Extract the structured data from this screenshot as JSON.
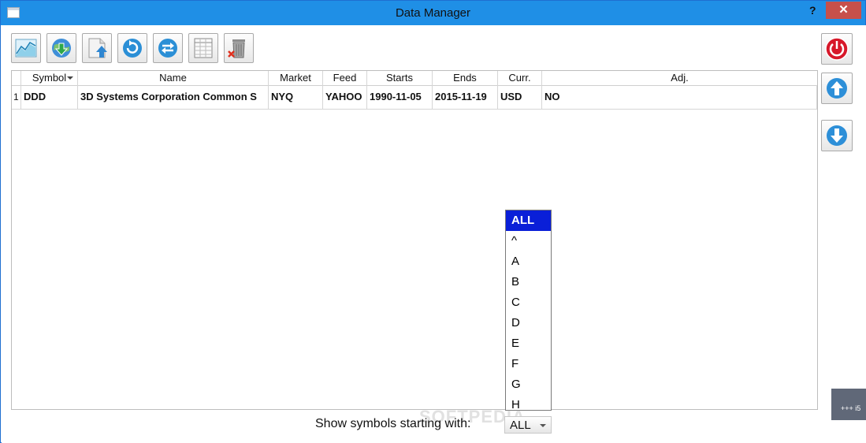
{
  "window": {
    "title": "Data Manager",
    "help": "?",
    "close": "✕"
  },
  "toolbar": [
    {
      "name": "chart-button",
      "icon": "chart-icon"
    },
    {
      "name": "download-button",
      "icon": "globe-download-icon"
    },
    {
      "name": "import-button",
      "icon": "document-upload-icon"
    },
    {
      "name": "refresh-button",
      "icon": "refresh-icon"
    },
    {
      "name": "sync-button",
      "icon": "sync-icon"
    },
    {
      "name": "table-button",
      "icon": "table-icon"
    },
    {
      "name": "delete-button",
      "icon": "trash-icon"
    }
  ],
  "table": {
    "columns": [
      "Symbol",
      "Name",
      "Market",
      "Feed",
      "Starts",
      "Ends",
      "Curr.",
      "Adj."
    ],
    "rows": [
      {
        "num": "1",
        "cells": [
          "DDD",
          "3D Systems Corporation Common S",
          "NYQ",
          "YAHOO",
          "1990-11-05",
          "2015-11-19",
          "USD",
          "NO"
        ]
      }
    ]
  },
  "side_buttons": [
    {
      "name": "power-button",
      "icon": "power-icon"
    },
    {
      "name": "move-up-button",
      "icon": "arrow-up-icon"
    },
    {
      "name": "move-down-button",
      "icon": "arrow-down-icon"
    }
  ],
  "filter": {
    "label": "Show symbols starting with:",
    "value": "ALL",
    "options": [
      "ALL",
      "^",
      "A",
      "B",
      "C",
      "D",
      "E",
      "F",
      "G",
      "H"
    ],
    "selected_index": 0
  },
  "watermark": "SOFTPEDIA",
  "corner_text": "+++ i5",
  "colors": {
    "titlebar": "#1f8fe6",
    "close": "#c7504b",
    "selection": "#0a1fd8"
  }
}
